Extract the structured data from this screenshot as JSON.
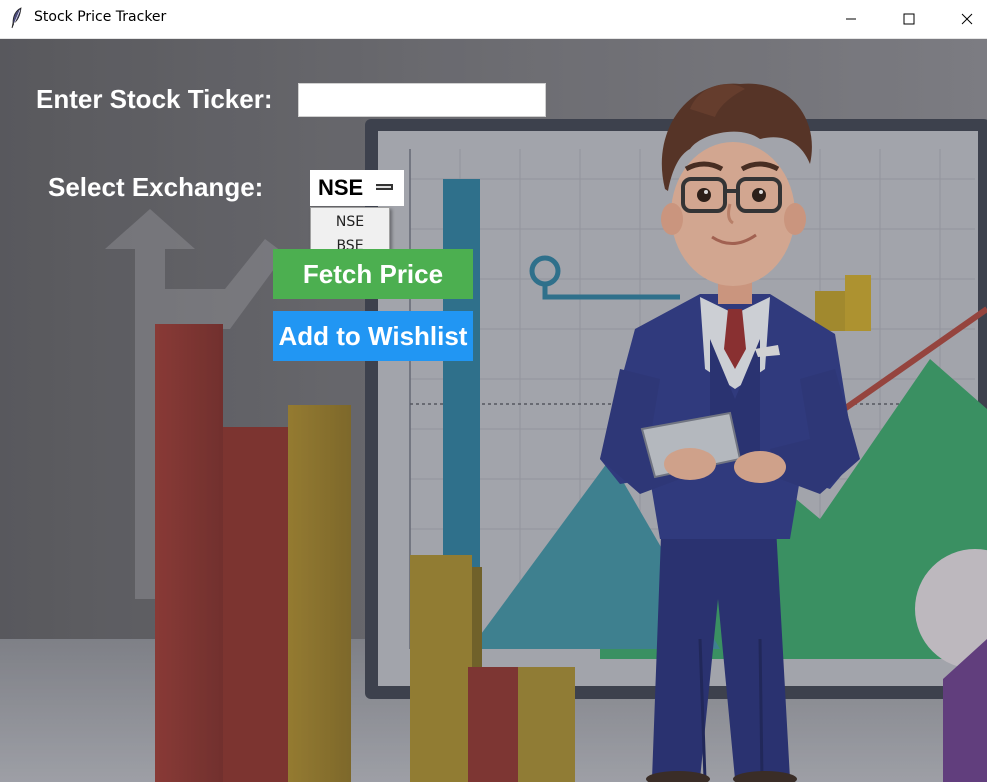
{
  "window": {
    "title": "Stock Price Tracker"
  },
  "form": {
    "ticker_label": "Enter Stock Ticker:",
    "ticker_value": "",
    "exchange_label": "Select Exchange:",
    "exchange_value": "NSE",
    "exchange_options": [
      "NSE",
      "BSE"
    ],
    "fetch_label": "Fetch Price",
    "wishlist_label": "Add to Wishlist"
  },
  "colors": {
    "fetch_button": "#4caf50",
    "wishlist_button": "#2196f3",
    "label_text": "#ffffff"
  }
}
